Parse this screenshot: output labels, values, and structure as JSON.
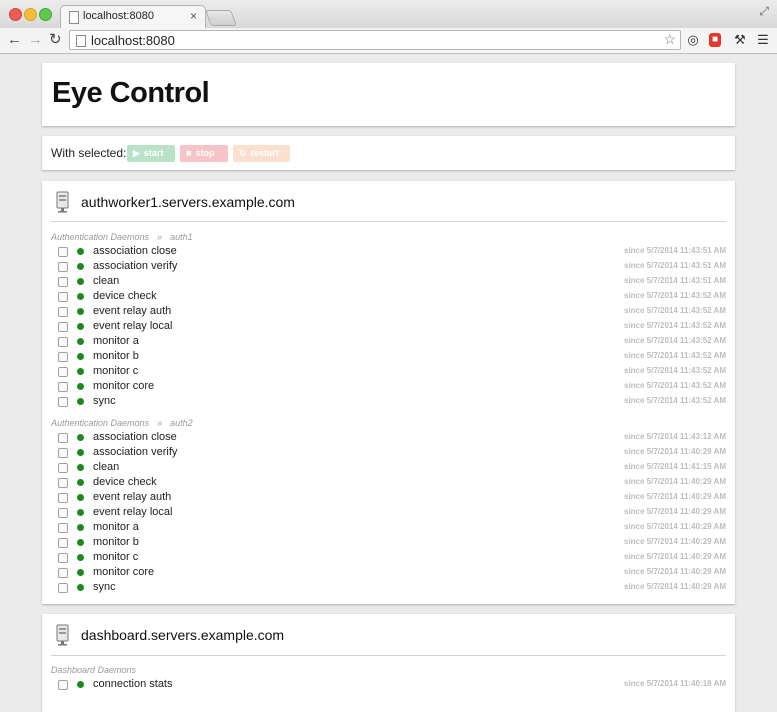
{
  "browser": {
    "tab_title": "localhost:8080",
    "tab_close": "×",
    "url": "localhost:8080",
    "icons": [
      "back-arrow-icon",
      "forward-arrow-icon",
      "reload-icon",
      "page-icon",
      "star-icon",
      "extension-icon",
      "wrench-icon",
      "menu-icon"
    ]
  },
  "page": {
    "title": "Eye Control",
    "actions": {
      "label": "With selected:",
      "start": "start",
      "stop": "stop",
      "restart": "restart",
      "colors": {
        "start": "#b9e3c6",
        "stop": "#f6c3c6",
        "restart": "#fbe0cf"
      }
    },
    "servers": [
      {
        "name": "authworker1.servers.example.com",
        "groups": [
          {
            "category": "Authentication Daemons",
            "separator": "»",
            "group": "auth1",
            "processes": [
              {
                "name": "association close",
                "since": "since 5/7/2014 11:43:51 AM"
              },
              {
                "name": "association verify",
                "since": "since 5/7/2014 11:43:51 AM"
              },
              {
                "name": "clean",
                "since": "since 5/7/2014 11:43:51 AM"
              },
              {
                "name": "device check",
                "since": "since 5/7/2014 11:43:52 AM"
              },
              {
                "name": "event relay auth",
                "since": "since 5/7/2014 11:43:52 AM"
              },
              {
                "name": "event relay local",
                "since": "since 5/7/2014 11:43:52 AM"
              },
              {
                "name": "monitor a",
                "since": "since 5/7/2014 11:43:52 AM"
              },
              {
                "name": "monitor b",
                "since": "since 5/7/2014 11:43:52 AM"
              },
              {
                "name": "monitor c",
                "since": "since 5/7/2014 11:43:52 AM"
              },
              {
                "name": "monitor core",
                "since": "since 5/7/2014 11:43:52 AM"
              },
              {
                "name": "sync",
                "since": "since 5/7/2014 11:43:52 AM"
              }
            ]
          },
          {
            "category": "Authentication Daemons",
            "separator": "»",
            "group": "auth2",
            "processes": [
              {
                "name": "association close",
                "since": "since 5/7/2014 11:43:12 AM"
              },
              {
                "name": "association verify",
                "since": "since 5/7/2014 11:40:29 AM"
              },
              {
                "name": "clean",
                "since": "since 5/7/2014 11:41:15 AM"
              },
              {
                "name": "device check",
                "since": "since 5/7/2014 11:40:29 AM"
              },
              {
                "name": "event relay auth",
                "since": "since 5/7/2014 11:40:29 AM"
              },
              {
                "name": "event relay local",
                "since": "since 5/7/2014 11:40:29 AM"
              },
              {
                "name": "monitor a",
                "since": "since 5/7/2014 11:40:29 AM"
              },
              {
                "name": "monitor b",
                "since": "since 5/7/2014 11:40:29 AM"
              },
              {
                "name": "monitor c",
                "since": "since 5/7/2014 11:40:29 AM"
              },
              {
                "name": "monitor core",
                "since": "since 5/7/2014 11:40:29 AM"
              },
              {
                "name": "sync",
                "since": "since 5/7/2014 11:40:29 AM"
              }
            ]
          }
        ]
      },
      {
        "name": "dashboard.servers.example.com",
        "groups": [
          {
            "category": "Dashboard Daemons",
            "processes": [
              {
                "name": "connection stats",
                "since": "since 5/7/2014 11:40:18 AM"
              }
            ]
          }
        ]
      }
    ],
    "status_color": "#1d8a1d"
  }
}
